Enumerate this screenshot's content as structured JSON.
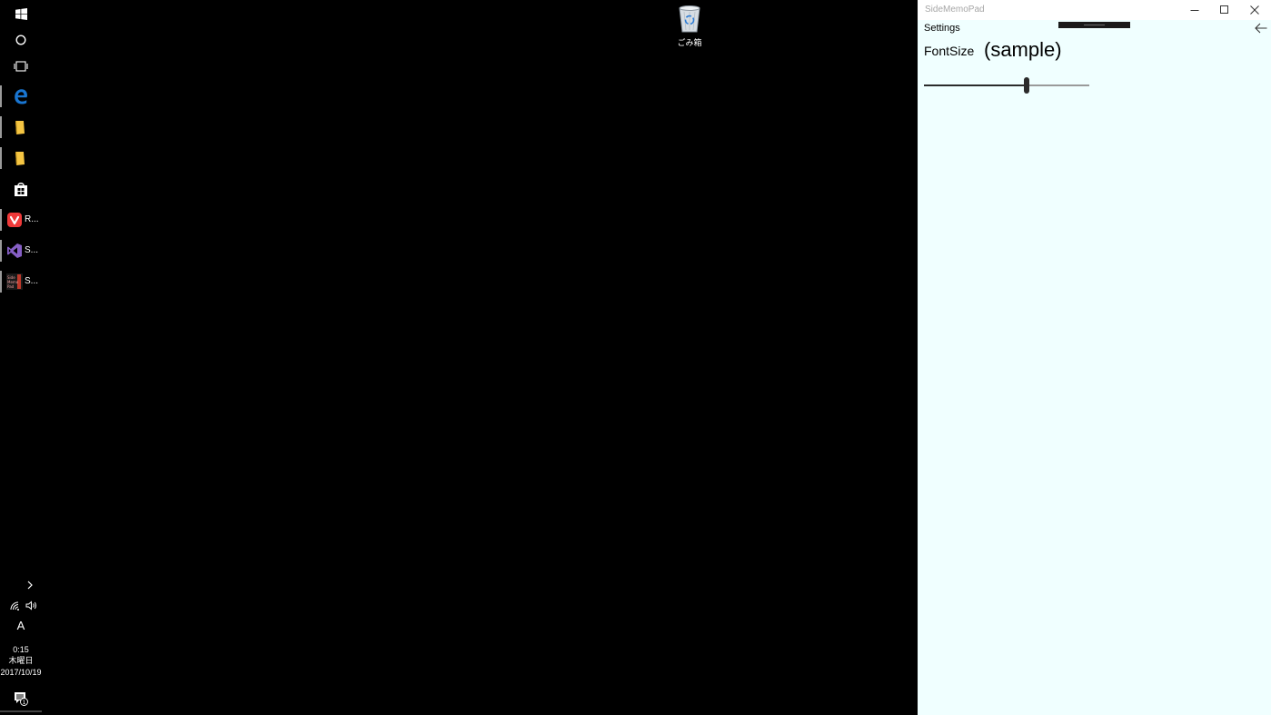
{
  "taskbar": {
    "start": {
      "icon": "windows-start-icon"
    },
    "search": {
      "icon": "cortana-circle-icon"
    },
    "task_view": {
      "icon": "task-view-icon"
    },
    "pinned": [
      {
        "name": "edge",
        "icon": "edge-browser-icon",
        "label": ""
      },
      {
        "name": "explorer-1",
        "icon": "file-explorer-icon",
        "label": ""
      },
      {
        "name": "explorer-2",
        "icon": "file-explorer-icon",
        "label": ""
      },
      {
        "name": "store",
        "icon": "store-bag-icon",
        "label": ""
      },
      {
        "name": "vivaldi",
        "icon": "vivaldi-icon",
        "label": "R..."
      },
      {
        "name": "visual-studio",
        "icon": "visual-studio-icon",
        "label": "S..."
      },
      {
        "name": "sidememopad",
        "icon": "sidememopad-app-icon",
        "label": "S..."
      }
    ],
    "tray": {
      "chevron_icon": "chevron-right-icon",
      "network_icon": "wifi-icon",
      "volume_icon": "speaker-icon",
      "ime_indicator": "A",
      "time": "0:15",
      "weekday": "木曜日",
      "date": "2017/10/19",
      "notifications_icon": "action-center-icon",
      "notification_count": "1"
    }
  },
  "desktop": {
    "icons": [
      {
        "label": "ごみ箱",
        "icon": "recycle-bin-icon"
      }
    ]
  },
  "window": {
    "title": "SideMemoPad",
    "controls": {
      "minimize_icon": "minimize-icon",
      "maximize_icon": "maximize-icon",
      "close_icon": "close-icon"
    },
    "header_label": "Settings",
    "back_icon": "back-arrow-icon",
    "font_size": {
      "label": "FontSize",
      "sample": "(sample)",
      "slider_value": 0.62
    }
  },
  "colors": {
    "desktop_bg": "#000000",
    "window_bg": "#f0ffff",
    "titlebar_bg": "#ffffff",
    "title_text": "#a6a6a6",
    "edge_blue": "#1976d2",
    "folder_yellow": "#f5c542",
    "vivaldi_red": "#ef3939",
    "vs_purple": "#865fc5"
  }
}
